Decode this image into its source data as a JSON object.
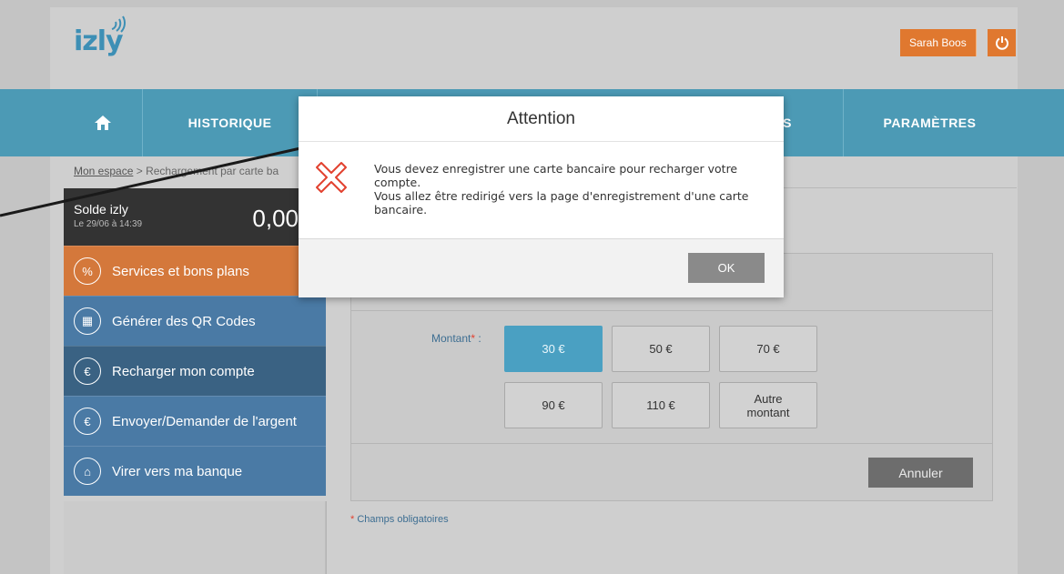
{
  "header": {
    "logo_text": "izly",
    "user_name": "Sarah Boos",
    "power_icon": "power-icon"
  },
  "nav": {
    "home_icon": "home-icon",
    "items": [
      {
        "label": "HISTORIQUE"
      },
      {
        "label": "S"
      },
      {
        "label": "PARAMÈTRES"
      }
    ]
  },
  "breadcrumb": {
    "home": "Mon espace",
    "separator": " > ",
    "current": "Rechargement par carte ba"
  },
  "sidebar": {
    "balance_label": "Solde izly",
    "balance_date": "Le 29/06 à 14:39",
    "balance_amount": "0,00",
    "items": [
      {
        "label": "Services et bons plans",
        "icon": "percent-icon",
        "glyph": "%"
      },
      {
        "label": "Générer des QR Codes",
        "icon": "qr-code-icon",
        "glyph": "▦"
      },
      {
        "label": "Recharger mon compte",
        "icon": "euro-refresh-icon",
        "glyph": "€"
      },
      {
        "label": "Envoyer/Demander de l'argent",
        "icon": "euro-send-icon",
        "glyph": "€"
      },
      {
        "label": "Virer vers ma banque",
        "icon": "bank-icon",
        "glyph": "⌂"
      }
    ]
  },
  "form": {
    "montant_label": "Montant",
    "required_star": "*",
    "label_suffix": " :",
    "amounts": [
      "30 €",
      "50 €",
      "70 €",
      "90 €",
      "110 €",
      "Autre montant"
    ],
    "selected_amount": "30 €",
    "cancel_label": "Annuler",
    "required_note": "Champs obligatoires"
  },
  "modal": {
    "title": "Attention",
    "message_line1": "Vous devez enregistrer une carte bancaire pour recharger votre compte.",
    "message_line2": "Vous allez être redirigé vers la page d'enregistrement d'une carte bancaire.",
    "ok_label": "OK",
    "icon": "error-x-icon"
  },
  "colors": {
    "accent_orange": "#e0782f",
    "nav_blue": "#4c9ab5",
    "selected_blue": "#4aa0c2",
    "error_red": "#e2412f"
  }
}
